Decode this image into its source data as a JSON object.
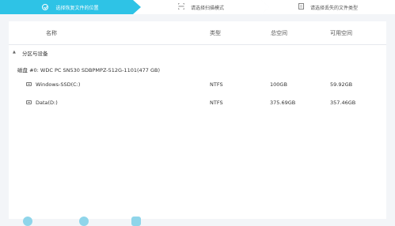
{
  "steps": [
    {
      "label": "选择恢复文件的位置",
      "icon": "check-circle-icon",
      "active": true
    },
    {
      "label": "请选择扫描模式",
      "icon": "scan-icon",
      "active": false
    },
    {
      "label": "请选择丢失的文件类型",
      "icon": "document-icon",
      "active": false
    }
  ],
  "table": {
    "columns": [
      "名称",
      "类型",
      "总空间",
      "可用空间"
    ],
    "group_label": "分区与设备",
    "disk_label": "磁盘 #0: WDC PC SN530 SDBPMPZ-512G-1101(477 GB)",
    "partitions": [
      {
        "name": "Windows-SSD(C:)",
        "type": "NTFS",
        "total": "100GB",
        "free": "59.92GB"
      },
      {
        "name": "Data(D:)",
        "type": "NTFS",
        "total": "375.69GB",
        "free": "357.46GB"
      }
    ]
  },
  "colors": {
    "accent": "#2ec3e6",
    "background": "#f3f5f8"
  }
}
